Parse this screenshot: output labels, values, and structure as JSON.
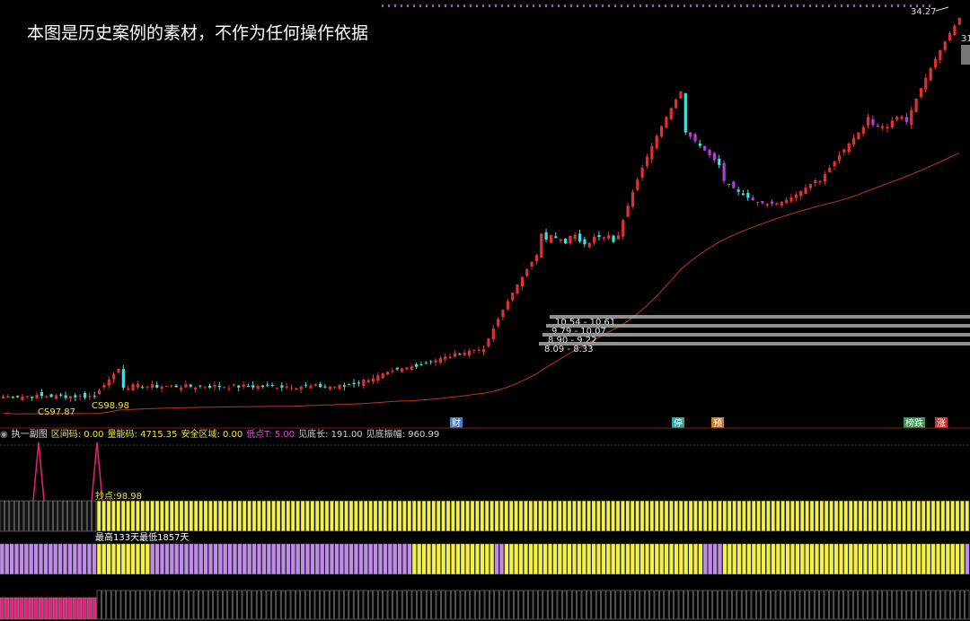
{
  "overlay_text": "本图是历史案例的素材，不作为任何操作依据",
  "price_labels": {
    "high": "34.27",
    "right_cut": "31",
    "cs1": "CS97.87",
    "cs2": "CS98.98"
  },
  "zones": [
    {
      "label": "10.54 - 10.61",
      "low": 10.54,
      "high": 10.61
    },
    {
      "label": "9.79 - 10.07",
      "low": 9.79,
      "high": 10.07
    },
    {
      "label": "8.90 - 9.22",
      "low": 8.9,
      "high": 9.22
    },
    {
      "label": "8.09 - 8.33",
      "low": 8.09,
      "high": 8.33
    }
  ],
  "event_tags": [
    {
      "text": "财",
      "color": "#3a7fd0"
    },
    {
      "text": "停",
      "color": "#2aa8a8"
    },
    {
      "text": "预",
      "color": "#d07a20"
    },
    {
      "text": "榜跌",
      "color": "#2c9c4a"
    },
    {
      "text": "涨",
      "color": "#d03030"
    }
  ],
  "indicator": {
    "name": "执一副图",
    "fields": [
      {
        "label": "区间码:",
        "value": "0.00",
        "color": "#e8e34a"
      },
      {
        "label": "量能码:",
        "value": "4715.35",
        "color": "#e8e34a"
      },
      {
        "label": "安全区域:",
        "value": "0.00",
        "color": "#e8e34a"
      },
      {
        "label": "低点T:",
        "value": "5.00",
        "color": "#d050d0"
      },
      {
        "label": "见底长:",
        "value": "191.00",
        "color": "#cfcfcf"
      },
      {
        "label": "见底振幅:",
        "value": "960.99",
        "color": "#cfcfcf"
      }
    ],
    "bottom_point_label": "抄点:98.98",
    "range_label": "最高133天最低1857天"
  },
  "colors": {
    "up": "#e23030",
    "down": "#3fe0e0",
    "purple": "#b03fd8",
    "ma": "#c0302a",
    "yellow": "#f2f04a",
    "lavender": "#c08be8",
    "pink": "#e8207a"
  },
  "chart_data": {
    "type": "candlestick",
    "description_free": true,
    "y_scale": "log",
    "price_range": [
      4.5,
      34.27
    ],
    "base_price": 5.2,
    "peak_price": 34.27
  }
}
